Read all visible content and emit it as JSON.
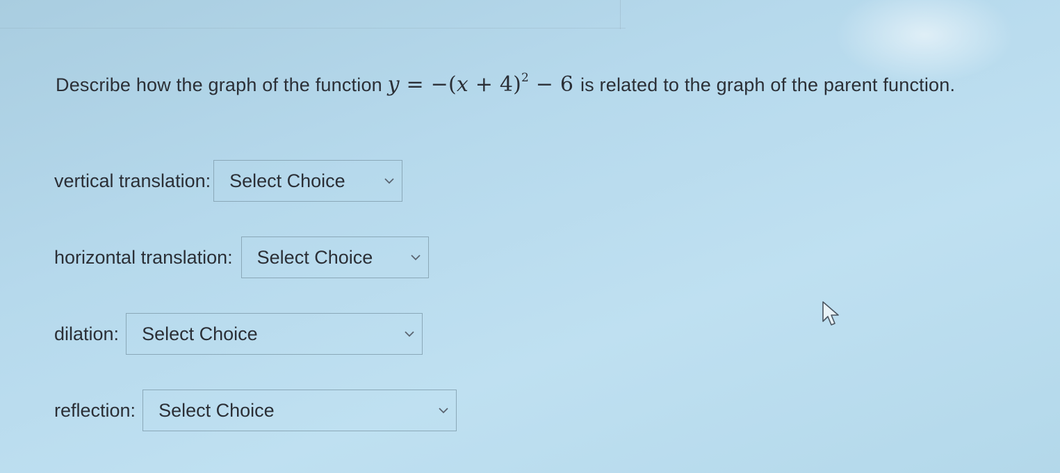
{
  "question": {
    "before": "Describe how the graph of the function",
    "equation": {
      "y": "y",
      "eq": "=",
      "minus": "−",
      "open": "(",
      "x": "x",
      "plus": "+",
      "four": "4",
      "close": ")",
      "exponent": "2",
      "minus2": "−",
      "six": "6"
    },
    "after": "is related to the graph of the parent function."
  },
  "fields": {
    "vertical": {
      "label": "vertical translation:",
      "value": "Select Choice"
    },
    "horizontal": {
      "label": "horizontal translation:",
      "value": "Select Choice"
    },
    "dilation": {
      "label": "dilation:",
      "value": "Select Choice"
    },
    "reflection": {
      "label": "reflection:",
      "value": "Select Choice"
    }
  },
  "icons": {
    "dropdown": "chevron-down-icon",
    "cursor": "mouse-pointer-icon"
  },
  "colors": {
    "background": "#b6d9ec",
    "text": "#2b2f36",
    "border": "#8aa8b8"
  }
}
